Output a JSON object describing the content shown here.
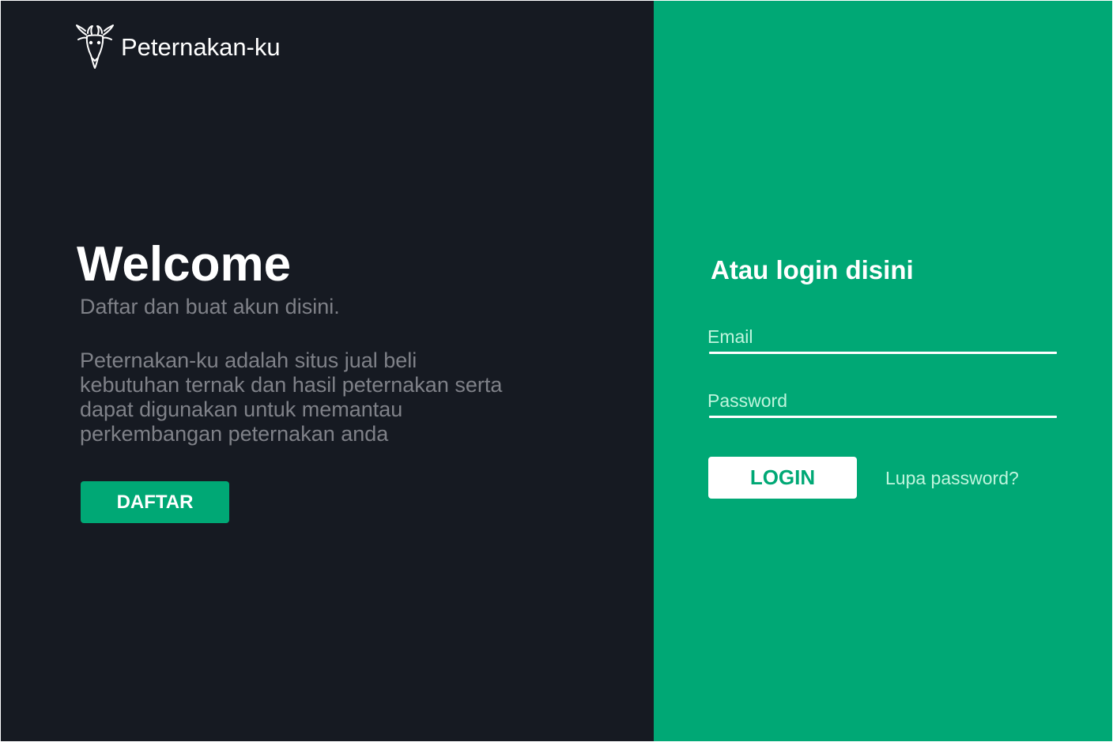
{
  "brand": {
    "name": "Peternakan-ku",
    "icon": "goat-head-icon"
  },
  "welcome": {
    "title": "Welcome",
    "subtitle": "Daftar dan buat akun disini.",
    "description": "Peternakan-ku adalah situs jual beli kebutuhan ternak dan hasil peternakan serta dapat digunakan untuk memantau perkembangan peternakan anda",
    "register_label": "DAFTAR"
  },
  "login": {
    "title": "Atau login disini",
    "email_placeholder": "Email",
    "email_value": "",
    "password_placeholder": "Password",
    "password_value": "",
    "login_label": "LOGIN",
    "forgot_label": "Lupa password?"
  },
  "colors": {
    "dark_background": "#161a22",
    "accent_green": "#00a875",
    "muted_text": "#7f8188",
    "light_green_text": "#bff5dd",
    "white": "#ffffff"
  }
}
